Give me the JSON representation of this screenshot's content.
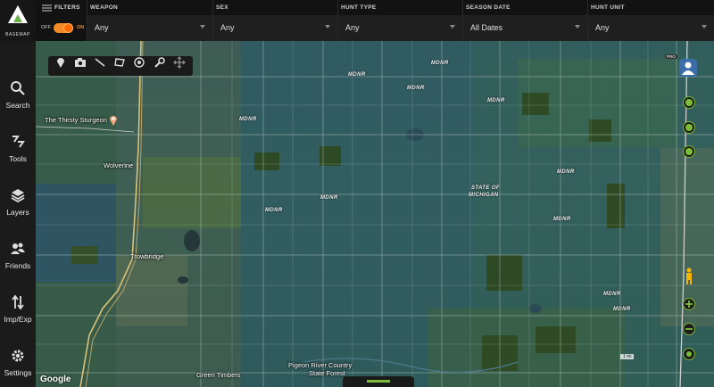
{
  "app": {
    "brand": "BASEMAP",
    "sidebar": [
      {
        "label": "Search",
        "icon": "search-icon"
      },
      {
        "label": "Tools",
        "icon": "tools-icon"
      },
      {
        "label": "Layers",
        "icon": "layers-icon"
      },
      {
        "label": "Friends",
        "icon": "friends-icon"
      },
      {
        "label": "Imp/Exp",
        "icon": "import-export-icon"
      },
      {
        "label": "Settings",
        "icon": "gear-icon"
      }
    ]
  },
  "filters": {
    "title": "FILTERS",
    "toggle_off": "OFF",
    "toggle_on": "ON",
    "toggle_state": "on",
    "columns": [
      {
        "label": "WEAPON",
        "value": "Any"
      },
      {
        "label": "SEX",
        "value": "Any"
      },
      {
        "label": "HUNT TYPE",
        "value": "Any"
      },
      {
        "label": "SEASON DATE",
        "value": "All Dates"
      },
      {
        "label": "HUNT UNIT",
        "value": "Any"
      }
    ]
  },
  "map": {
    "tools": [
      "marker-icon",
      "camera-icon",
      "line-icon",
      "polygon-icon",
      "radius-icon",
      "wrench-icon",
      "move-icon"
    ],
    "labels": [
      "MDNR",
      "MDNR",
      "MDNR",
      "MDNR",
      "MDNR",
      "MDNR",
      "MDNR",
      "MDNR",
      "MDNR",
      "MDNR",
      "MDNR"
    ],
    "state_label": [
      "STATE OF",
      "MICHIGAN"
    ],
    "places": {
      "sturgeon": "The Thirsty Sturgeon",
      "wolverine": "Wolverine",
      "trowbridge": "Trowbridge",
      "pigeon": "Pigeon River Country",
      "pigeon2": "State Forest",
      "timbers": "Green Timbers"
    },
    "pro_badge": "PRO",
    "google": "Google",
    "scale": "1 mi"
  },
  "colors": {
    "accent_orange": "#f28a25",
    "accent_green": "#7dbb3a",
    "bar_bg": "#121212",
    "sidebar_bg": "#1b1b1b"
  }
}
